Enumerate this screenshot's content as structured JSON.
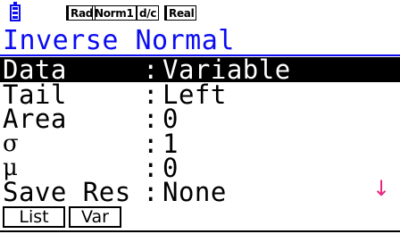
{
  "status_bar": {
    "battery_icon": "battery-icon",
    "angle_mode": "Rad",
    "display_mode": "Norm1",
    "fraction_mode": "d/c",
    "complex_mode": "Real"
  },
  "title": "Inverse Normal",
  "rows": [
    {
      "label": "Data",
      "colon": ":",
      "value": "Variable",
      "selected": true
    },
    {
      "label": "Tail",
      "colon": ":",
      "value": "Left",
      "selected": false
    },
    {
      "label": "Area",
      "colon": ":",
      "value": "0",
      "selected": false
    },
    {
      "label": "σ",
      "colon": ":",
      "value": "1",
      "selected": false
    },
    {
      "label": "μ",
      "colon": ":",
      "value": "0",
      "selected": false
    },
    {
      "label": "Save Res",
      "colon": ":",
      "value": "None",
      "selected": false
    }
  ],
  "scroll_indicator": "↓",
  "function_keys": [
    "List",
    "Var"
  ],
  "colors": {
    "title": "#0b0cf0",
    "selection_bg": "#000000",
    "scroll_arrow": "#e8267e"
  }
}
